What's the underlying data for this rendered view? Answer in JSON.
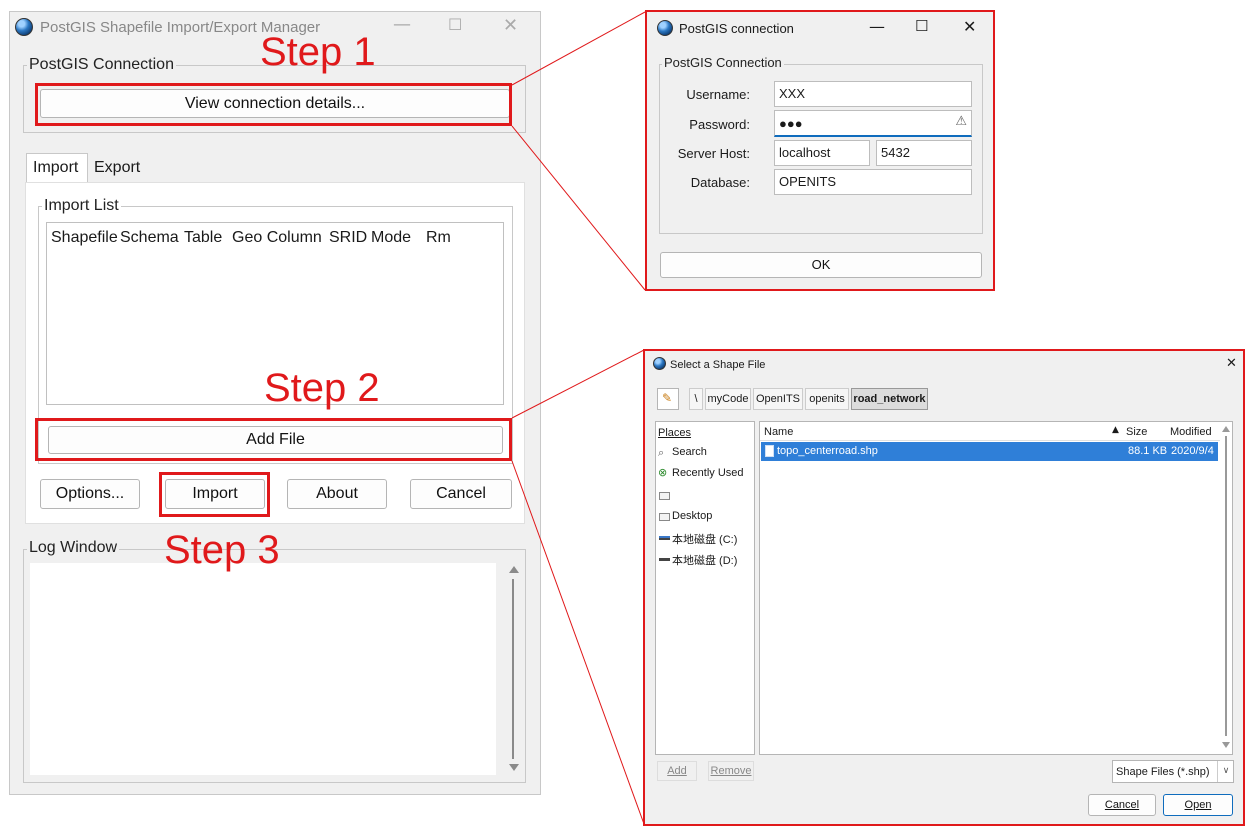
{
  "main": {
    "title": "PostGIS Shapefile Import/Export Manager",
    "connection_group": "PostGIS Connection",
    "view_connection_button": "View connection details...",
    "tabs": [
      "Import",
      "Export"
    ],
    "import_list_group": "Import List",
    "columns": [
      "Shapefile",
      "Schema",
      "Table",
      "Geo Column",
      "SRID",
      "Mode",
      "Rm"
    ],
    "add_file_button": "Add File",
    "options_button": "Options...",
    "import_button": "Import",
    "about_button": "About",
    "cancel_button": "Cancel",
    "log_group": "Log Window"
  },
  "annotations": {
    "step1": "Step 1",
    "step2": "Step 2",
    "step3": "Step 3"
  },
  "conn": {
    "title": "PostGIS connection",
    "group": "PostGIS Connection",
    "username_label": "Username:",
    "username": "XXX",
    "password_label": "Password:",
    "password": "●●●",
    "server_label": "Server Host:",
    "host": "localhost",
    "port": "5432",
    "database_label": "Database:",
    "database": "OPENITS",
    "ok_button": "OK"
  },
  "file_dialog": {
    "title": "Select a Shape File",
    "path_root": "\\",
    "path": [
      "myCode",
      "OpenITS",
      "openits",
      "road_network"
    ],
    "places_header": "Places",
    "places": [
      "Search",
      "Recently Used",
      "",
      "Desktop",
      "本地磁盘 (C:)",
      "本地磁盘 (D:)"
    ],
    "col_name": "Name",
    "col_size": "Size",
    "col_modified": "Modified",
    "file_name": "topo_centerroad.shp",
    "file_size": "88.1 KB",
    "file_modified": "2020/9/4",
    "add_button": "Add",
    "remove_button": "Remove",
    "filter": "Shape Files (*.shp)",
    "cancel_button": "Cancel",
    "open_button": "Open"
  }
}
